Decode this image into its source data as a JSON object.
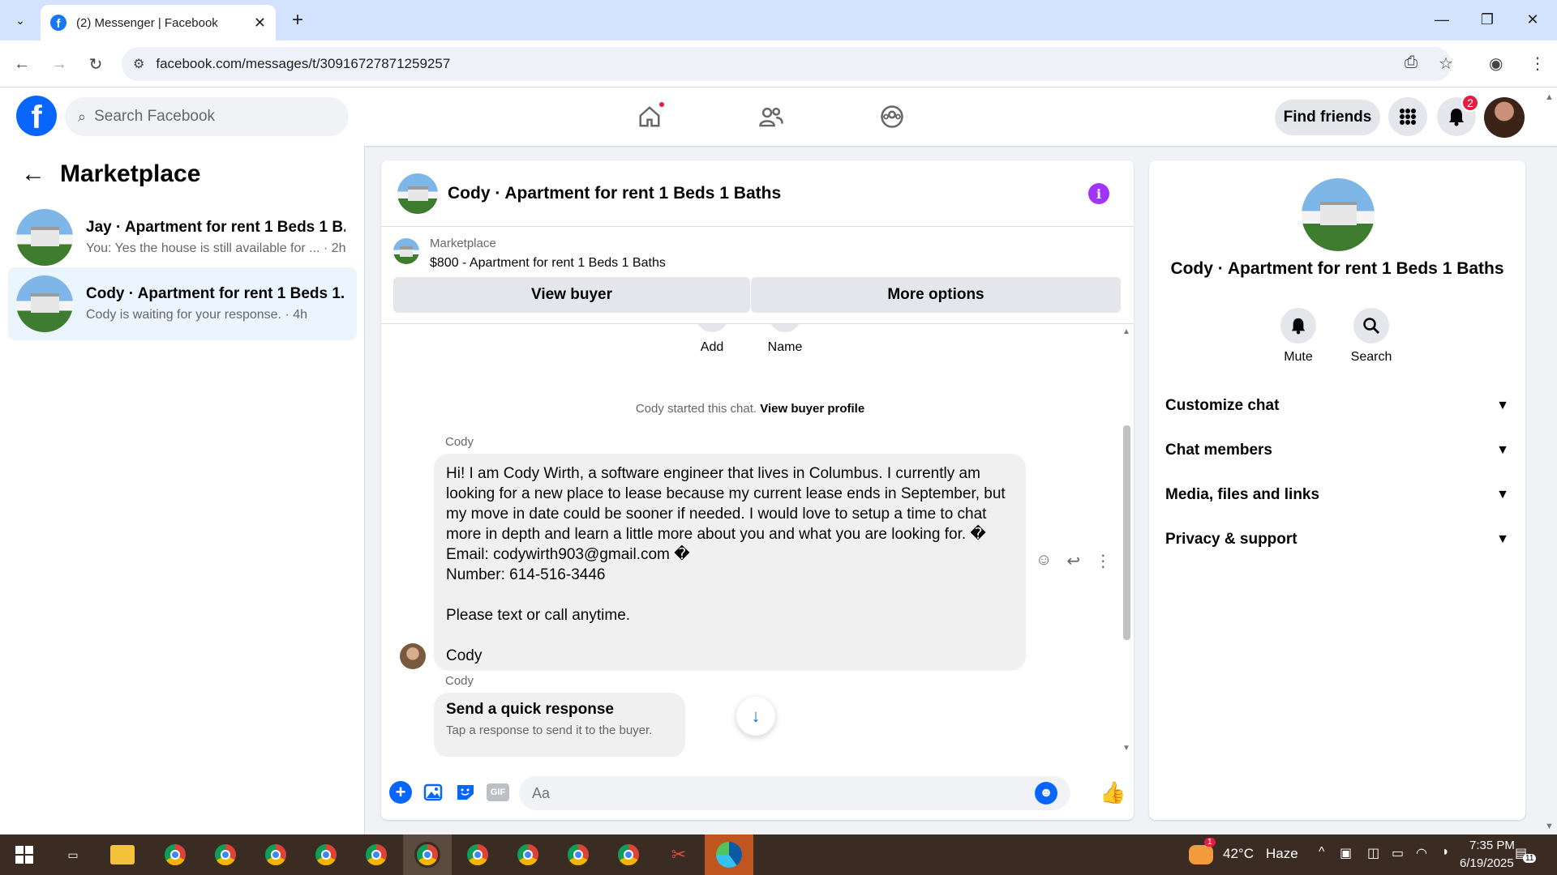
{
  "browser": {
    "tab_title": "(2) Messenger | Facebook",
    "url": "facebook.com/messages/t/30916727871259257"
  },
  "fb": {
    "search_placeholder": "Search Facebook",
    "find_friends": "Find friends",
    "notif_count": "2"
  },
  "sidebar": {
    "title": "Marketplace",
    "conversations": [
      {
        "name": "Jay · Apartment for rent 1 Beds 1 B...",
        "preview": "You: Yes the house is still available for ... · 2h"
      },
      {
        "name": "Cody · Apartment for rent 1 Beds 1...",
        "preview": "Cody is waiting for your response. · 4h"
      }
    ]
  },
  "chat": {
    "title": "Cody · Apartment for rent 1 Beds 1 Baths",
    "listing_label": "Marketplace",
    "listing_price": "$800 - Apartment for rent 1 Beds 1 Baths",
    "view_buyer": "View buyer",
    "more_options": "More options",
    "add_label": "Add",
    "name_label": "Name",
    "started_text": "Cody started this chat.",
    "view_buyer_profile": "View buyer profile",
    "sender": "Cody",
    "message_lines": [
      "Hi! I am Cody Wirth, a software engineer that lives in Columbus. I currently am",
      "looking for a new place to lease because my current lease ends in September, but",
      "my move in date could be sooner if needed. I would love to setup a time to chat",
      "more in depth and learn a little more about you and what you are looking for. �",
      "Email: codywirth903@gmail.com �",
      "Number: 614-516-3446",
      "",
      "Please text or call anytime.",
      "",
      "Cody"
    ],
    "sender2": "Cody",
    "quick_title": "Send a quick response",
    "quick_sub": "Tap a response to send it to the buyer.",
    "composer_placeholder": "Aa"
  },
  "right": {
    "name": "Cody · Apartment for rent 1 Beds 1 Baths",
    "mute": "Mute",
    "search": "Search",
    "sections": [
      "Customize chat",
      "Chat members",
      "Media, files and links",
      "Privacy & support"
    ]
  },
  "taskbar": {
    "temp": "42°C",
    "weather": "Haze",
    "weather_alert": "1",
    "time": "7:35 PM",
    "date": "6/19/2025",
    "notif": "11"
  },
  "icons": {
    "brand": "#0866ff",
    "info": "#a033ff"
  }
}
